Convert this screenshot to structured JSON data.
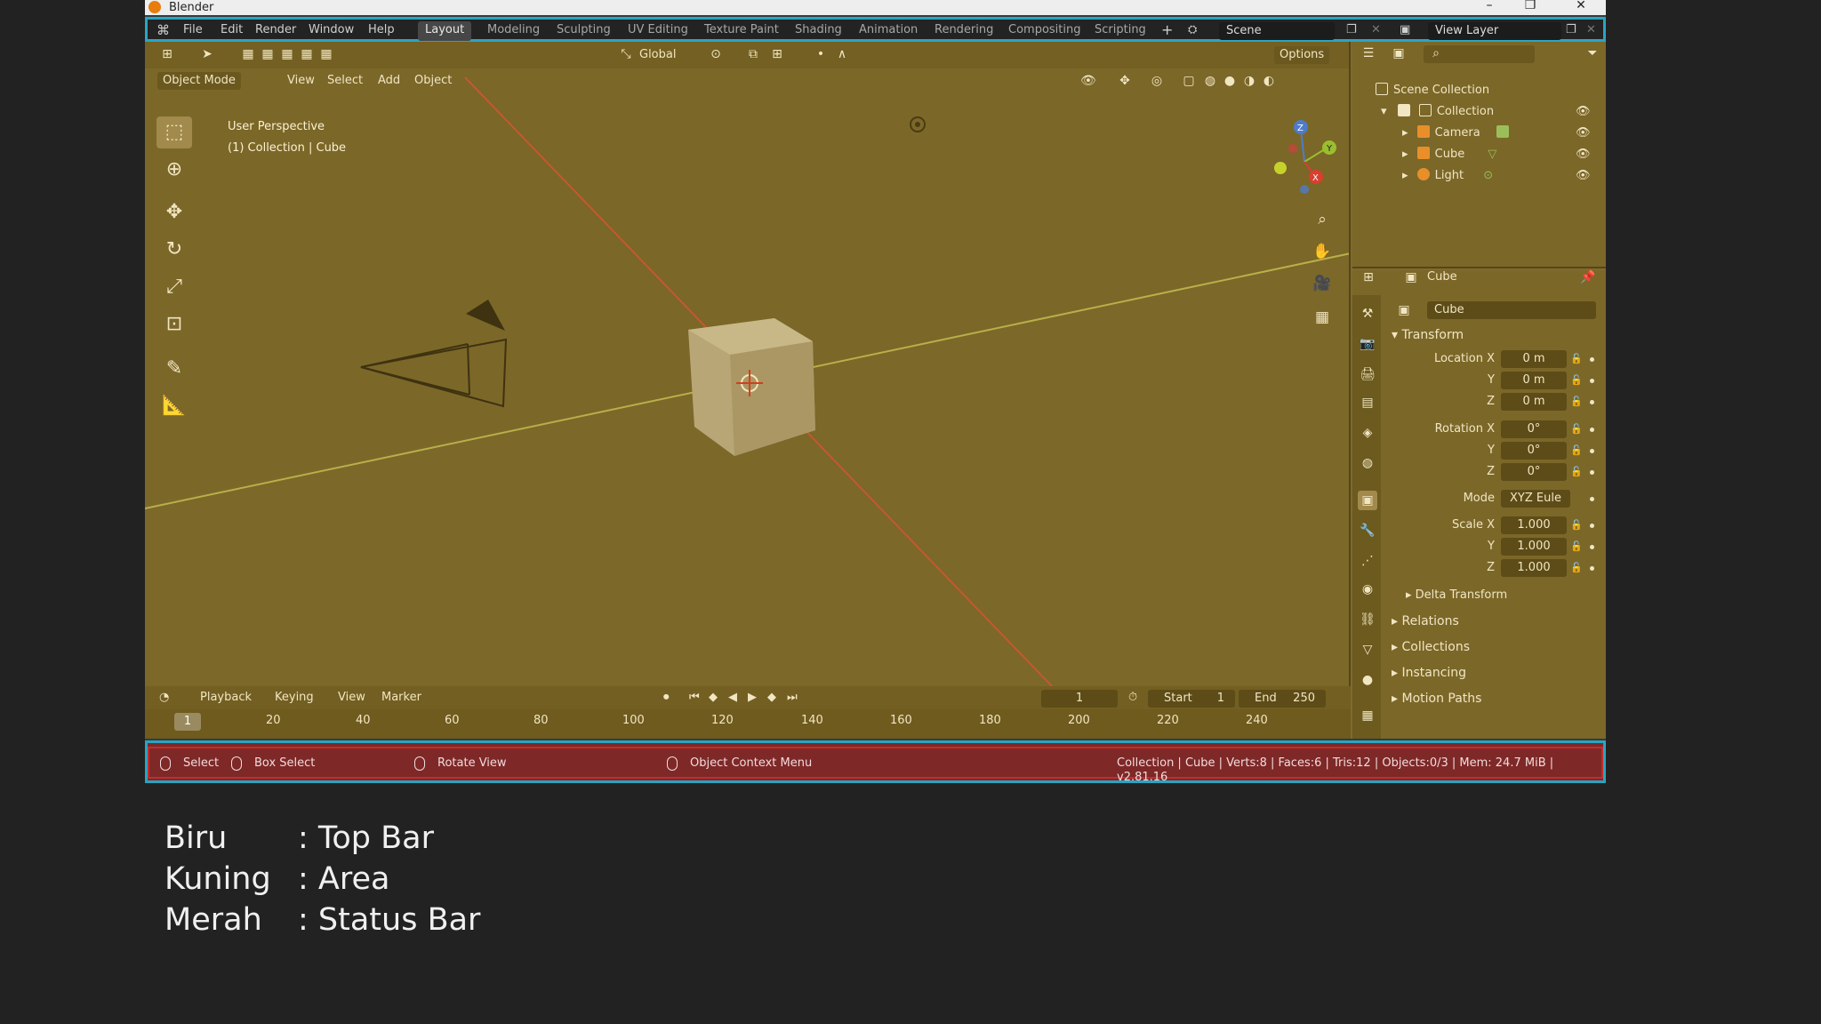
{
  "window": {
    "title": "Blender"
  },
  "menu": [
    "File",
    "Edit",
    "Render",
    "Window",
    "Help"
  ],
  "workspaces": [
    "Layout",
    "Modeling",
    "Sculpting",
    "UV Editing",
    "Texture Paint",
    "Shading",
    "Animation",
    "Rendering",
    "Compositing",
    "Scripting"
  ],
  "active_workspace": "Layout",
  "scene": {
    "name": "Scene",
    "view_layer": "View Layer"
  },
  "viewport": {
    "mode": "Object Mode",
    "header_menus": [
      "View",
      "Select",
      "Add",
      "Object"
    ],
    "transform_orientation": "Global",
    "options_label": "Options",
    "overlay_line1": "User Perspective",
    "overlay_line2": "(1) Collection | Cube"
  },
  "gizmo_axes": {
    "x": "X",
    "y": "Y",
    "z": "Z"
  },
  "timeline": {
    "menus": [
      "Playback",
      "Keying",
      "View",
      "Marker"
    ],
    "current_frame": "1",
    "start_label": "Start",
    "start": "1",
    "end_label": "End",
    "end": "250",
    "ticks": [
      "1",
      "20",
      "40",
      "60",
      "80",
      "100",
      "120",
      "140",
      "160",
      "180",
      "200",
      "220",
      "240"
    ]
  },
  "outliner": {
    "root": "Scene Collection",
    "collection": "Collection",
    "objects": [
      {
        "name": "Camera",
        "color": "#e88f2a"
      },
      {
        "name": "Cube",
        "color": "#e88f2a"
      },
      {
        "name": "Light",
        "color": "#e88f2a"
      }
    ]
  },
  "properties": {
    "header_object": "Cube",
    "object_name": "Cube",
    "transform_label": "Transform",
    "location_label": "Location X",
    "location": [
      "0 m",
      "0 m",
      "0 m"
    ],
    "rotation_label": "Rotation X",
    "rotation": [
      "0°",
      "0°",
      "0°"
    ],
    "mode_label": "Mode",
    "mode_value": "XYZ Eule",
    "scale_label": "Scale X",
    "scale": [
      "1.000",
      "1.000",
      "1.000"
    ],
    "axis_y": "Y",
    "axis_z": "Z",
    "sections": [
      "Delta Transform",
      "Relations",
      "Collections",
      "Instancing",
      "Motion Paths"
    ]
  },
  "statusbar": {
    "select": "Select",
    "box_select": "Box Select",
    "rotate_view": "Rotate View",
    "context_menu": "Object Context Menu",
    "stats": "Collection | Cube | Verts:8 | Faces:6 | Tris:12 | Objects:0/3 | Mem: 24.7 MiB | v2.81.16"
  },
  "legend": [
    {
      "color_name": "Biru",
      "label": ": Top Bar"
    },
    {
      "color_name": "Kuning",
      "label": ": Area"
    },
    {
      "color_name": "Merah",
      "label": ": Status Bar"
    }
  ],
  "colors": {
    "top_bar_highlight": "#28a6c4",
    "area_highlight": "#806a2c",
    "status_bar_highlight": "#7e2828"
  }
}
